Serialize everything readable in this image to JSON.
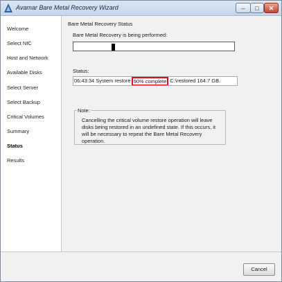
{
  "window": {
    "title": "Avamar Bare Metal Recovery Wizard",
    "controls": {
      "minimize": "–",
      "maximize": "□",
      "close": "✕"
    }
  },
  "sidebar": {
    "items": [
      {
        "label": "Welcome"
      },
      {
        "label": "Select NIC"
      },
      {
        "label": "Host and Network"
      },
      {
        "label": "Available Disks"
      },
      {
        "label": "Select Server"
      },
      {
        "label": "Select Backup"
      },
      {
        "label": "Critical Volumes"
      },
      {
        "label": "Summary"
      },
      {
        "label": "Status"
      },
      {
        "label": "Results"
      }
    ],
    "active": "Status"
  },
  "main": {
    "section_title": "Bare Metal Recovery Status",
    "progress": {
      "label": "Bare Metal Recovery is being performed:",
      "indeterminate": true
    },
    "status": {
      "label": "Status:",
      "prefix": "06:43:34 System restore",
      "highlight": "90% complete",
      "suffix": "C:\\restored 164.7 GB.",
      "highlight_color": "#d9111e"
    },
    "note": {
      "legend": "Note:",
      "text": "Cancelling the critical volume restore operation will leave disks being restored in an undefined state. If this occurs, it will be necessary to repeat the Bare Metal Recovery operation."
    }
  },
  "footer": {
    "cancel_label": "Cancel"
  },
  "icons": {
    "app": "avamar-logo-icon"
  }
}
